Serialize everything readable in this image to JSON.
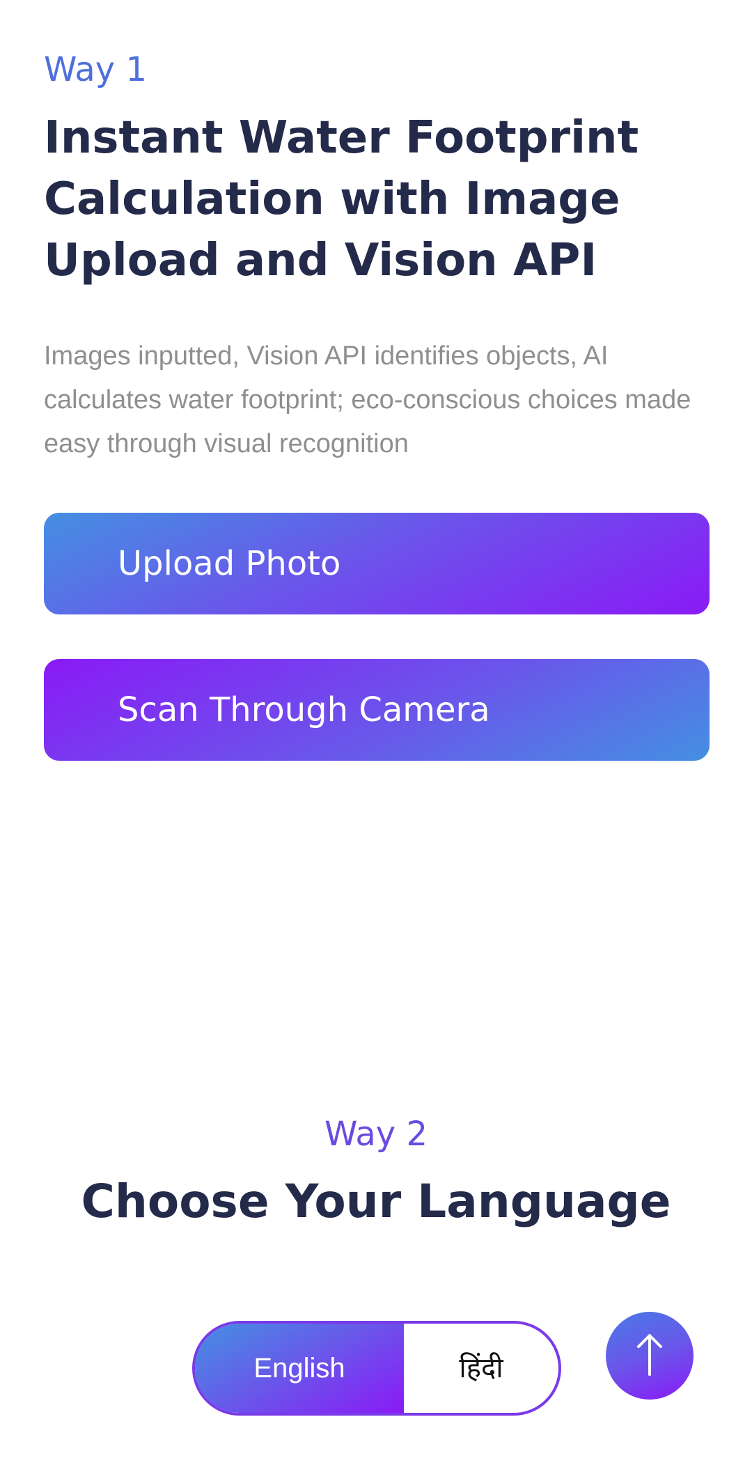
{
  "way1": {
    "label": "Way 1",
    "title": "Instant Water Footprint Calculation with Image Upload and Vision API",
    "description": "Images inputted, Vision API identifies objects, AI calculates water footprint; eco-conscious choices made easy through visual recognition",
    "upload_button": "Upload Photo",
    "camera_button": "Scan Through Camera"
  },
  "way2": {
    "label": "Way 2",
    "title": "Choose Your Language",
    "languages": [
      {
        "label": "English",
        "selected": true
      },
      {
        "label": "हिंदी",
        "selected": false
      }
    ]
  },
  "scroll_top": {
    "icon": "arrow-up-icon"
  },
  "colors": {
    "accent_blue": "#4490e2",
    "accent_purple": "#8a1af6",
    "heading": "#242a4a",
    "body_text": "#8f8f8f"
  }
}
